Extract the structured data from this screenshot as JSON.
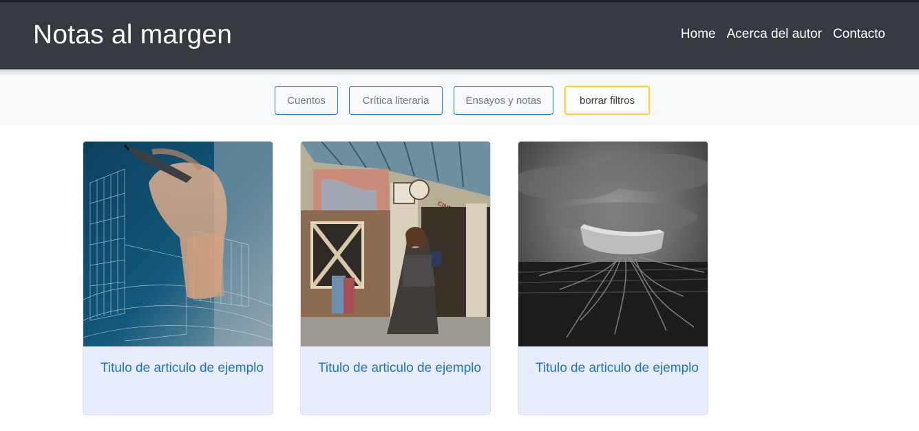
{
  "header": {
    "brand": "Notas al margen",
    "nav": [
      "Home",
      "Acerca del autor",
      "Contacto"
    ]
  },
  "filters": {
    "buttons": [
      "Cuentos",
      "Crítica literaria",
      "Ensayos y notas"
    ],
    "clear_label": "borrar filtros"
  },
  "articles": [
    {
      "title": "Titulo de articulo de ejemplo",
      "image": "blueprint-hand-drawing-illustration"
    },
    {
      "title": "Titulo de articulo de ejemplo",
      "image": "woman-at-cinema-entrance-illustration",
      "image_text": "CINE"
    },
    {
      "title": "Titulo de articulo de ejemplo",
      "image": "boat-with-roots-monochrome-photo"
    }
  ],
  "colors": {
    "navbar": "#343a40",
    "filterbar": "#f8f9fa",
    "button_border": "#1e78c8",
    "clear_border": "#ffd24c",
    "card_body": "#e7edfa",
    "link": "#1a73c9"
  }
}
